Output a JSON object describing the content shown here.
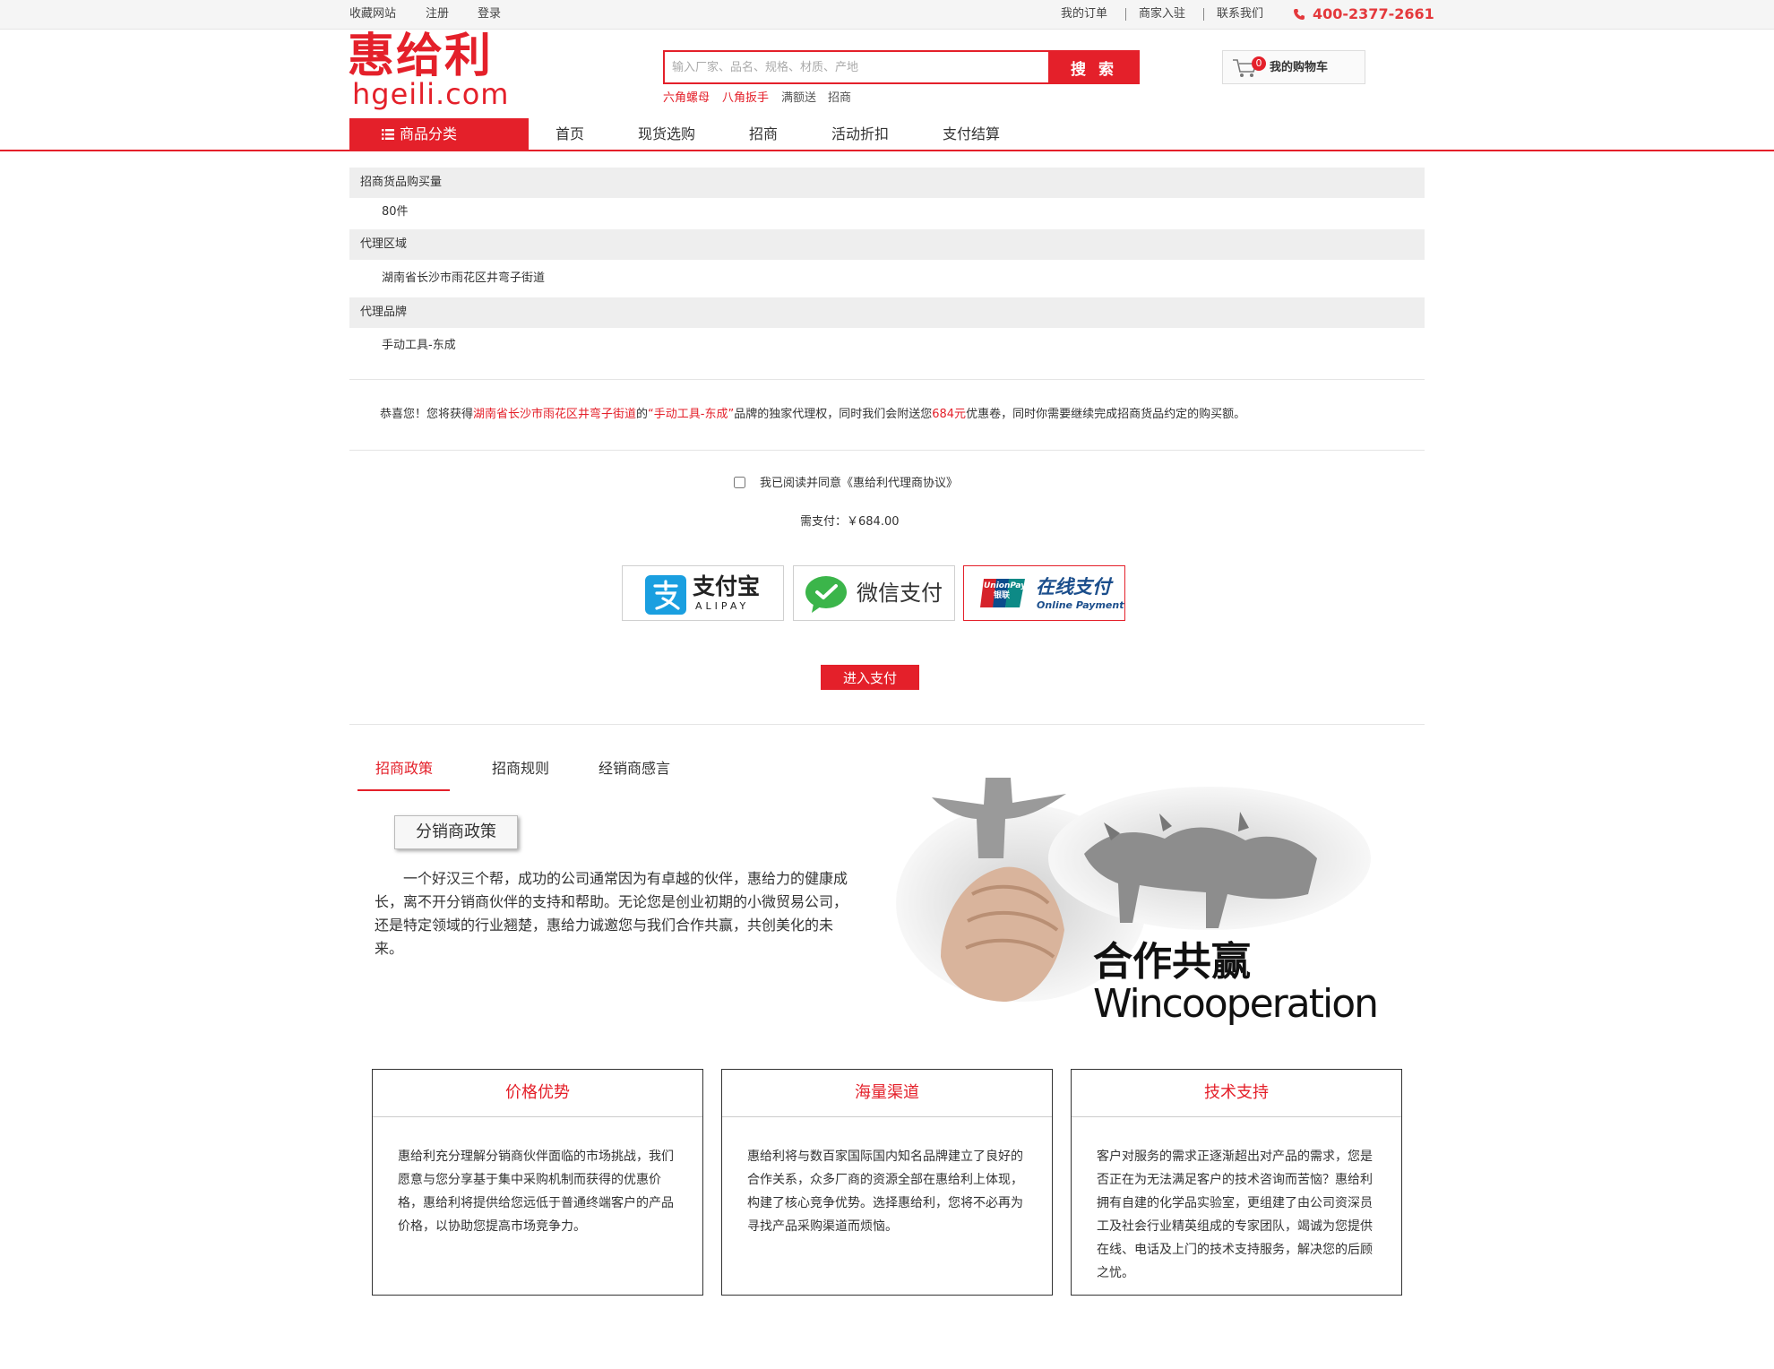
{
  "topbar": {
    "left_links": [
      "收藏网站",
      "注册",
      "登录"
    ],
    "right_links": [
      "我的订单",
      "商家入驻",
      "联系我们"
    ],
    "phone": "400-2377-2661"
  },
  "logo": {
    "cn": "惠给利",
    "en": "hgeili.com"
  },
  "search": {
    "placeholder": "输入厂家、品名、规格、材质、产地",
    "button": "搜 索",
    "hot": [
      "六角螺母",
      "八角扳手",
      "满额送",
      "招商"
    ]
  },
  "cart": {
    "label": "我的购物车",
    "count": "0"
  },
  "nav": {
    "category": "商品分类",
    "items": [
      "首页",
      "现货选购",
      "招商",
      "活动折扣",
      "支付结算"
    ]
  },
  "details": {
    "qty_label": "招商货品购买量",
    "qty_value": "80件",
    "region_label": "代理区域",
    "region_value": "湖南省长沙市雨花区井弯子街道",
    "brand_label": "代理品牌",
    "brand_value": "手动工具-东成"
  },
  "congrats": {
    "p1": "恭喜您！您将获得",
    "region": "湖南省长沙市雨花区井弯子街道",
    "p2": "的",
    "brand": "“手动工具-东成”",
    "p3": "品牌的独家代理权，同时我们会附送您",
    "amount": "684元",
    "p4": "优惠卷，同时你需要继续完成招商货品约定的购买额。"
  },
  "agreement": "我已阅读并同意《惠给利代理商协议》",
  "pay_amount": "需支付：￥684.00",
  "payment_methods": {
    "alipay_cn": "支付宝",
    "alipay_en": "ALIPAY",
    "wechat": "微信支付",
    "union_cn": "在线支付",
    "union_en": "Online Payment",
    "union_logo_top": "UnionPay",
    "union_logo_cn": "银联"
  },
  "pay_button": "进入支付",
  "tabs": [
    "招商政策",
    "招商规则",
    "经销商感言"
  ],
  "policy": {
    "badge": "分销商政策",
    "text": "一个好汉三个帮，成功的公司通常因为有卓越的伙伴，惠给力的健康成长，离不开分销商伙伴的支持和帮助。无论您是创业初期的小微贸易公司，还是特定领域的行业翘楚，惠给力诚邀您与我们合作共赢，共创美化的未来。"
  },
  "banner": {
    "cn": "合作共赢",
    "en": "Wincooperation"
  },
  "features": [
    {
      "title": "价格优势",
      "text": "惠给利充分理解分销商伙伴面临的市场挑战，我们愿意与您分享基于集中采购机制而获得的优惠价格，惠给利将提供给您远低于普通终端客户的产品价格，以协助您提高市场竞争力。"
    },
    {
      "title": "海量渠道",
      "text": "惠给利将与数百家国际国内知名品牌建立了良好的合作关系，众多厂商的资源全部在惠给利上体现，构建了核心竞争优势。选择惠给利，您将不必再为寻找产品采购渠道而烦恼。"
    },
    {
      "title": "技术支持",
      "text": "客户对服务的需求正逐渐超出对产品的需求，您是否正在为无法满足客户的技术咨询而苦恼？惠给利拥有自建的化学品实验室，更组建了由公司资深员工及社会行业精英组成的专家团队，竭诚为您提供在线、电话及上门的技术支持服务，解决您的后顾之忧。"
    }
  ],
  "colors": {
    "brand": "#e4202a",
    "band": "#eeeeee"
  }
}
